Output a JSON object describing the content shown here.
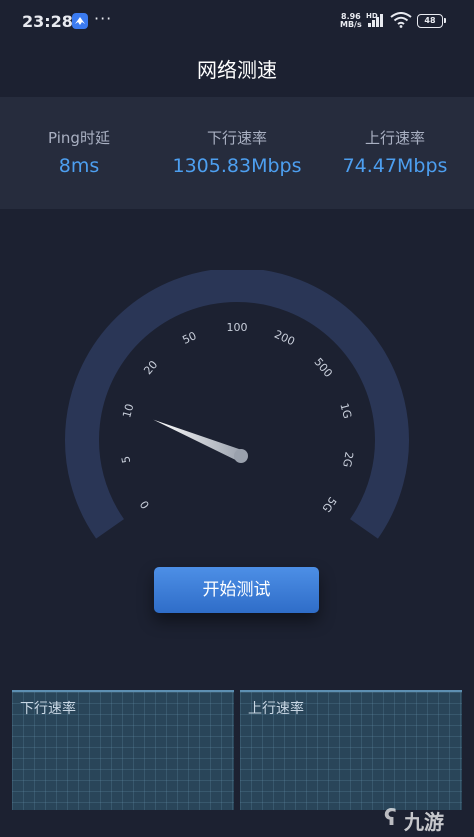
{
  "statusbar": {
    "time": "23:28",
    "dots": "···",
    "net_speed_value": "8.96",
    "net_speed_unit": "MB/s",
    "hd": "HD",
    "battery": "48"
  },
  "title": "网络测速",
  "stats": {
    "ping_label": "Ping时延",
    "ping_value": "8ms",
    "down_label": "下行速率",
    "down_value": "1305.83Mbps",
    "up_label": "上行速率",
    "up_value": "74.47Mbps"
  },
  "gauge": {
    "ticks": [
      "0",
      "5",
      "10",
      "20",
      "50",
      "100",
      "200",
      "500",
      "1G",
      "2G",
      "5G"
    ],
    "needle_value_index": 2.3
  },
  "start_button": "开始测试",
  "panels": {
    "down_label": "下行速率",
    "up_label": "上行速率"
  },
  "watermark": "九游",
  "colors": {
    "background": "#1c2131",
    "accent": "#4d9ff0",
    "button": "#3a7fd9",
    "gauge_ring": "#2a3656"
  }
}
